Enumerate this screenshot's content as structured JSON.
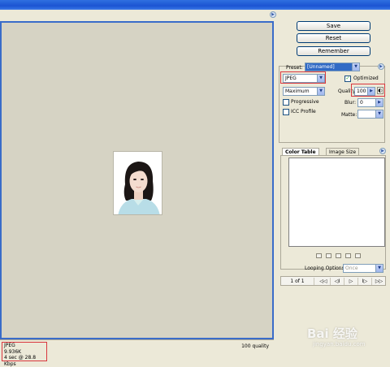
{
  "buttons": {
    "save": "Save",
    "reset": "Reset",
    "remember": "Remember"
  },
  "settings": {
    "preset_label": "Preset:",
    "preset_value": "[Unnamed]",
    "format_value": "JPEG",
    "optimized_label": "Optimized",
    "optimized_checked": true,
    "compression_value": "Maximum",
    "quality_label": "Quality:",
    "quality_value": "100",
    "progressive_label": "Progressive",
    "progressive_checked": false,
    "icc_label": "ICC Profile",
    "icc_checked": false,
    "blur_label": "Blur:",
    "blur_value": "0",
    "matte_label": "Matte:",
    "matte_value": ""
  },
  "tabs": {
    "color_table": "Color Table",
    "image_size": "Image Size"
  },
  "animation": {
    "looping_label": "Looping Options:",
    "looping_value": "Once",
    "frame_counter": "1 of 1",
    "controls": [
      "◁◁",
      "◁I",
      "▷",
      "I▷",
      "▷▷"
    ]
  },
  "status": {
    "format": "JPEG",
    "size": "9.936K",
    "download_time": "4 sec @ 28.8 Kbps",
    "quality": "100 quality"
  },
  "watermark": {
    "brand": "Bai 经验",
    "url": "jingyan.baidu.com"
  },
  "colors": {
    "accent_red": "#d9373e",
    "frame_blue": "#3a6cc9",
    "canvas_bg": "#d6d3c4"
  }
}
